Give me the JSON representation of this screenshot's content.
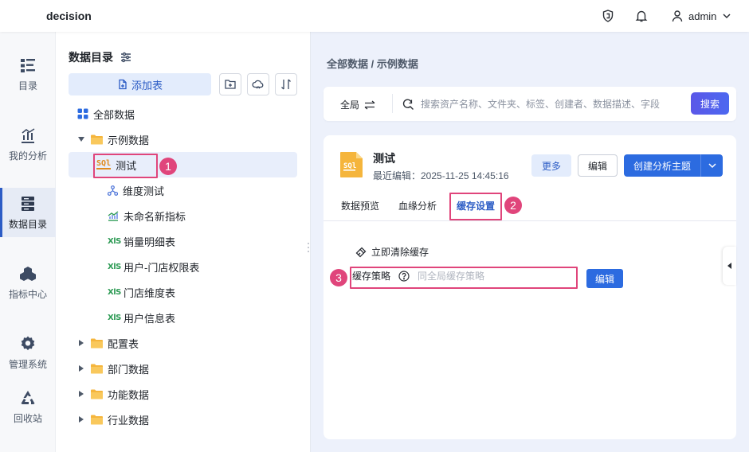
{
  "header": {
    "brand": "decision",
    "user_name": "admin",
    "icons": [
      "shield-icon",
      "bell-icon",
      "user-icon",
      "chevron-down-icon"
    ]
  },
  "left_nav": {
    "items": [
      {
        "label": "目录",
        "icon": "menu-list-icon"
      },
      {
        "label": "我的分析",
        "icon": "bar-chart-icon"
      },
      {
        "label": "数据目录",
        "icon": "database-icon",
        "active": true
      },
      {
        "label": "指标中心",
        "icon": "cubes-icon"
      },
      {
        "label": "管理系统",
        "icon": "gear-icon"
      },
      {
        "label": "回收站",
        "icon": "recycle-icon"
      }
    ]
  },
  "tree_panel": {
    "title": "数据目录",
    "add_table_label": "添加表",
    "items": [
      {
        "label": "全部数据",
        "icon": "grid-icon",
        "depth": 0
      },
      {
        "label": "示例数据",
        "icon": "folder-icon",
        "depth": 0,
        "expanded": true
      },
      {
        "label": "测试",
        "icon": "sql-icon",
        "icon_text": "SQl",
        "depth": 1,
        "selected": true
      },
      {
        "label": "维度测试",
        "icon": "hierarchy-icon",
        "depth": 1
      },
      {
        "label": "未命名新指标",
        "icon": "metric-icon",
        "depth": 1
      },
      {
        "label": "销量明细表",
        "icon": "xls-icon",
        "icon_text": "XlS",
        "depth": 1
      },
      {
        "label": "用户-门店权限表",
        "icon": "xls-icon",
        "icon_text": "XlS",
        "depth": 1
      },
      {
        "label": "门店维度表",
        "icon": "xls-icon",
        "icon_text": "XlS",
        "depth": 1
      },
      {
        "label": "用户信息表",
        "icon": "xls-icon",
        "icon_text": "XlS",
        "depth": 1
      },
      {
        "label": "配置表",
        "icon": "folder-icon",
        "depth": 0
      },
      {
        "label": "部门数据",
        "icon": "folder-icon",
        "depth": 0
      },
      {
        "label": "功能数据",
        "icon": "folder-icon",
        "depth": 0
      },
      {
        "label": "行业数据",
        "icon": "folder-icon",
        "depth": 0
      }
    ]
  },
  "main": {
    "breadcrumb": "全部数据 / 示例数据",
    "search": {
      "scope_label": "全局",
      "placeholder": "搜索资产名称、文件夹、标签、创建者、数据描述、字段",
      "button": "搜索"
    },
    "card": {
      "title": "测试",
      "file_icon_text": "SQl",
      "meta": "最近编辑：2025-11-25 14:45:16",
      "buttons": {
        "more": "更多",
        "edit": "编辑",
        "create": "创建分析主题"
      },
      "tabs": [
        "数据预览",
        "血缘分析",
        "缓存设置"
      ],
      "active_tab": "缓存设置",
      "clear_cache": "立即清除缓存",
      "policy_label": "缓存策略",
      "policy_value": "同全局缓存策略",
      "policy_edit": "编辑"
    }
  },
  "annotations": [
    "1",
    "2",
    "3"
  ],
  "colors": {
    "accent": "#2c6be0",
    "highlight": "#e0457b",
    "xls_green": "#2e9b55",
    "sql_orange": "#e08a1e",
    "folder_yellow": "#f5b53c"
  }
}
